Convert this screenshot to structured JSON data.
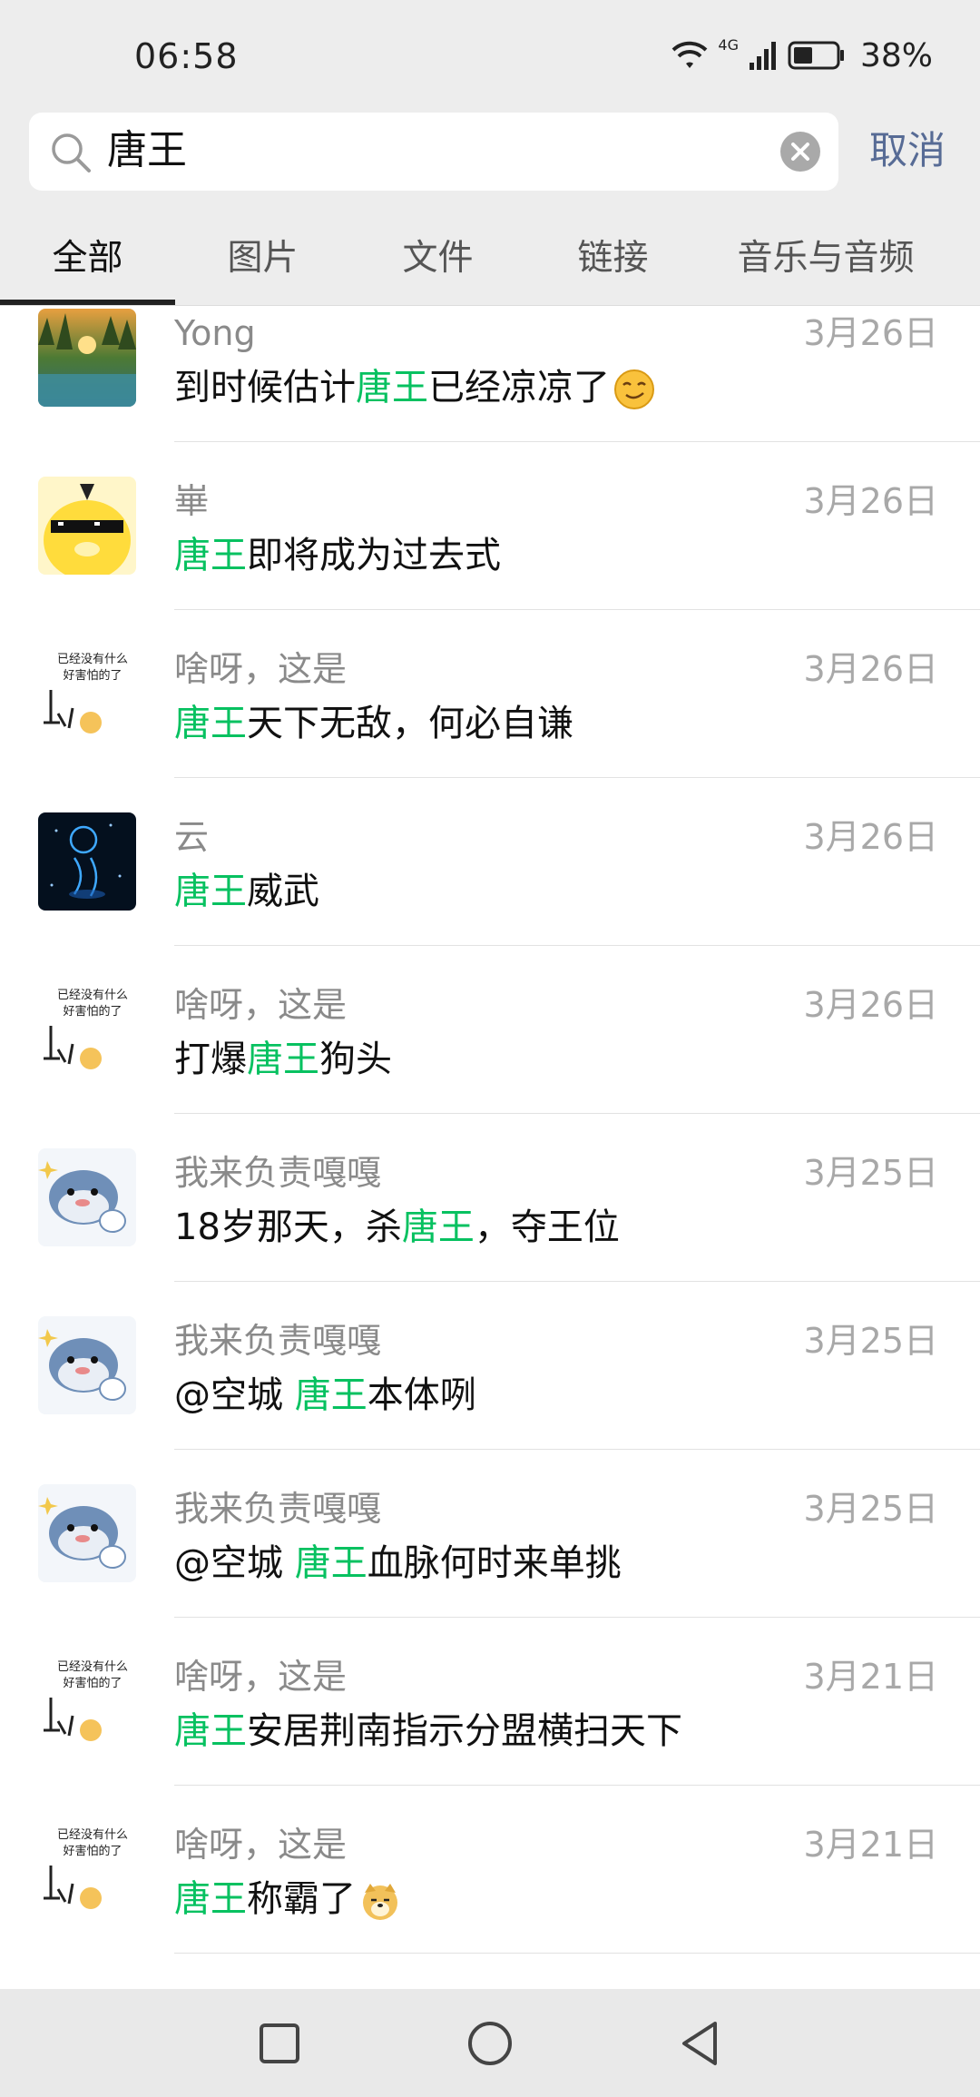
{
  "status": {
    "time": "06:58",
    "network": "4G",
    "battery": "38%"
  },
  "search": {
    "query": "唐王"
  },
  "header": {
    "cancel_label": "取消"
  },
  "tabs": [
    "全部",
    "图片",
    "文件",
    "链接",
    "音乐与音频"
  ],
  "colors": {
    "highlight": "#07c160",
    "link": "#576b95",
    "background": "#ededed"
  },
  "results": [
    {
      "name": "Yong",
      "date": "3月26日",
      "before": "到时候估计",
      "keyword": "唐王",
      "after": "已经凉凉了",
      "emoji": "smirk-emoji",
      "avatar": "forest-avatar"
    },
    {
      "name": "崋",
      "date": "3月26日",
      "before": "",
      "keyword": "唐王",
      "after": "即将成为过去式",
      "emoji": "",
      "avatar": "duck-avatar"
    },
    {
      "name": "啥呀，这是",
      "date": "3月26日",
      "before": "",
      "keyword": "唐王",
      "after": "天下无敌，何必自谦",
      "emoji": "",
      "avatar": "meme-avatar"
    },
    {
      "name": "云",
      "date": "3月26日",
      "before": "",
      "keyword": "唐王",
      "after": "威武",
      "emoji": "",
      "avatar": "space-avatar"
    },
    {
      "name": "啥呀，这是",
      "date": "3月26日",
      "before": "打爆",
      "keyword": "唐王",
      "after": "狗头",
      "emoji": "",
      "avatar": "meme-avatar"
    },
    {
      "name": "我来负责嘎嘎",
      "date": "3月25日",
      "before": "18岁那天，杀",
      "keyword": "唐王",
      "after": "，夺王位",
      "emoji": "",
      "avatar": "seal-avatar"
    },
    {
      "name": "我来负责嘎嘎",
      "date": "3月25日",
      "before": "@空城 ",
      "keyword": "唐王",
      "after": "本体咧",
      "emoji": "",
      "avatar": "seal-avatar"
    },
    {
      "name": "我来负责嘎嘎",
      "date": "3月25日",
      "before": "@空城 ",
      "keyword": "唐王",
      "after": "血脉何时来单挑",
      "emoji": "",
      "avatar": "seal-avatar"
    },
    {
      "name": "啥呀，这是",
      "date": "3月21日",
      "before": "",
      "keyword": "唐王",
      "after": "安居荆南指示分盟横扫天下",
      "emoji": "",
      "avatar": "meme-avatar"
    },
    {
      "name": "啥呀，这是",
      "date": "3月21日",
      "before": "",
      "keyword": "唐王",
      "after": "称霸了",
      "emoji": "doge-emoji",
      "avatar": "meme-avatar"
    }
  ],
  "meme_avatar_text": [
    "已经没有什么",
    "好害怕的了"
  ]
}
